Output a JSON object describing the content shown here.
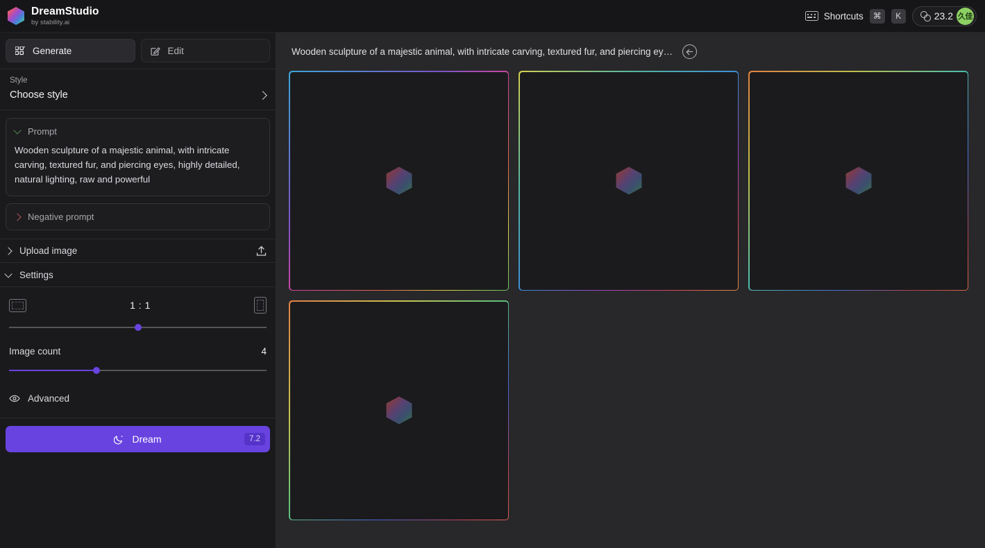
{
  "brand": {
    "title": "DreamStudio",
    "subtitle": "by stability.ai",
    "logo_icon": "hexagon-gradient-icon"
  },
  "topbar": {
    "shortcuts_label": "Shortcuts",
    "shortcuts_icon": "keyboard-icon",
    "keys": [
      "⌘",
      "K"
    ],
    "credits_icon": "coin-icon",
    "credits_value": "23.2",
    "avatar_initials": "久佳",
    "avatar_color": "#8ed163"
  },
  "sidebar": {
    "tabs": [
      {
        "label": "Generate",
        "icon": "grid-icon",
        "active": true
      },
      {
        "label": "Edit",
        "icon": "pencil-square-icon",
        "active": false
      }
    ],
    "style": {
      "label": "Style",
      "value": "Choose style",
      "chevron_icon": "chevron-right-icon"
    },
    "prompt": {
      "title": "Prompt",
      "chevron_icon": "chevron-down-icon",
      "chevron_color": "#4f8b4f",
      "text": "Wooden sculpture of a majestic animal, with intricate carving, textured fur, and piercing eyes, highly detailed, natural lighting, raw and powerful"
    },
    "negative_prompt": {
      "title": "Negative prompt",
      "chevron_icon": "chevron-right-icon",
      "chevron_color": "#b5595c"
    },
    "upload_image": {
      "label": "Upload image",
      "chevron_icon": "chevron-right-icon",
      "action_icon": "upload-icon"
    },
    "settings": {
      "label": "Settings",
      "chevron_icon": "chevron-down-icon",
      "aspect_ratio": {
        "value": "1 : 1",
        "left_icon": "landscape-frame-icon",
        "right_icon": "portrait-frame-icon",
        "slider_percent": 50
      },
      "image_count": {
        "label": "Image count",
        "value": "4",
        "slider_percent": 34
      }
    },
    "advanced": {
      "label": "Advanced",
      "icon": "eye-icon"
    },
    "dream_button": {
      "label": "Dream",
      "icon": "moon-icon",
      "badge": "7.2",
      "color": "#6943e0"
    }
  },
  "main": {
    "header_text": "Wooden sculpture of a majestic animal, with intricate carving, textured fur, and piercing ey…",
    "back_icon": "back-arrow-circle-icon",
    "cards": [
      {
        "name": "generated-image-1",
        "border_gradient": "linear-gradient(135deg, #3aa6d8 0%, #7a55c8 34%, #d3449c 52%, #e06a4a 72%, #d9d14c 86%, #69c060 100%)",
        "placeholder_icon": "hexagon-gradient-icon"
      },
      {
        "name": "generated-image-2",
        "border_gradient": "linear-gradient(135deg, #d3d04e 0%, #55b6a0 26%, #3c8fd6 50%, #9747c6 68%, #d6455f 84%, #e08a45 100%)",
        "placeholder_icon": "hexagon-gradient-icon"
      },
      {
        "name": "generated-image-3",
        "border_gradient": "linear-gradient(135deg, #e0803f 0%, #c0c04c 24%, #4fbfa7 48%, #4a6fd6 70%, #b6414f 88%, #d76a46 100%)",
        "placeholder_icon": "hexagon-gradient-icon"
      },
      {
        "name": "generated-image-4",
        "border_gradient": "linear-gradient(135deg, #e08045 0%, #c8c451 26%, #5fc07a 48%, #4a63d8 70%, #c0415c 88%, #d85f52 100%)",
        "placeholder_icon": "hexagon-gradient-icon"
      }
    ]
  },
  "colors": {
    "app_background": "#1a1a1d",
    "main_background": "#28282a",
    "topbar_background": "#161618",
    "accent_purple": "#6943e0",
    "card_interior": "#1b1b1d"
  }
}
